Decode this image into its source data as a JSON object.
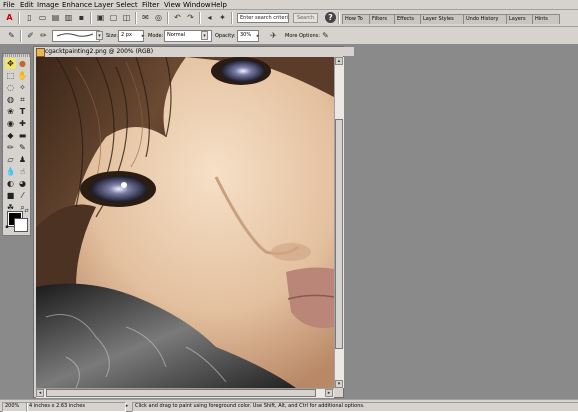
{
  "menu": [
    "File",
    "Edit",
    "Image",
    "Enhance",
    "Layer",
    "Select",
    "Filter",
    "View",
    "Window",
    "Help"
  ],
  "shortcuts": {
    "search_placeholder": "Enter search criteria",
    "search_button": "Search",
    "help_icon": "?"
  },
  "palette_tabs": [
    "How To",
    "Filters",
    "Effects",
    "Layer Styles",
    "Undo History",
    "Layers",
    "Hints"
  ],
  "options": {
    "size_label": "Size:",
    "size_value": "2 px",
    "mode_label": "Mode:",
    "mode_value": "Normal",
    "opacity_label": "Opacity:",
    "opacity_value": "30%",
    "more_options_label": "More Options:"
  },
  "document": {
    "title": "cgacktpainting2.png @ 200% (RGB)"
  },
  "colors": {
    "foreground": "#000000",
    "background": "#ffffff",
    "app_bg": "#8a8a8a",
    "chrome": "#d6d3ce"
  },
  "status": {
    "zoom": "200%",
    "dimensions": "4 inches x 2.63 inches",
    "hint": "Click and drag to paint using foreground color.  Use Shift, Alt, and Ctrl for additional options."
  },
  "icons": {
    "menu": [],
    "toolbox": [
      "move-tool-icon",
      "zoom-tool-icon",
      "hand-tool-icon",
      "eyedropper-icon",
      "marquee-icon",
      "lasso-icon",
      "magic-wand-icon",
      "selection-brush-icon",
      "type-tool-icon",
      "crop-icon",
      "cookie-cutter-icon",
      "straighten-icon",
      "red-eye-icon",
      "healing-brush-icon",
      "clone-stamp-icon",
      "pencil-icon",
      "eraser-icon",
      "brush-icon",
      "paint-bucket-icon",
      "gradient-icon",
      "shape-icon",
      "blur-icon",
      "sponge-icon",
      "smudge-icon"
    ]
  }
}
